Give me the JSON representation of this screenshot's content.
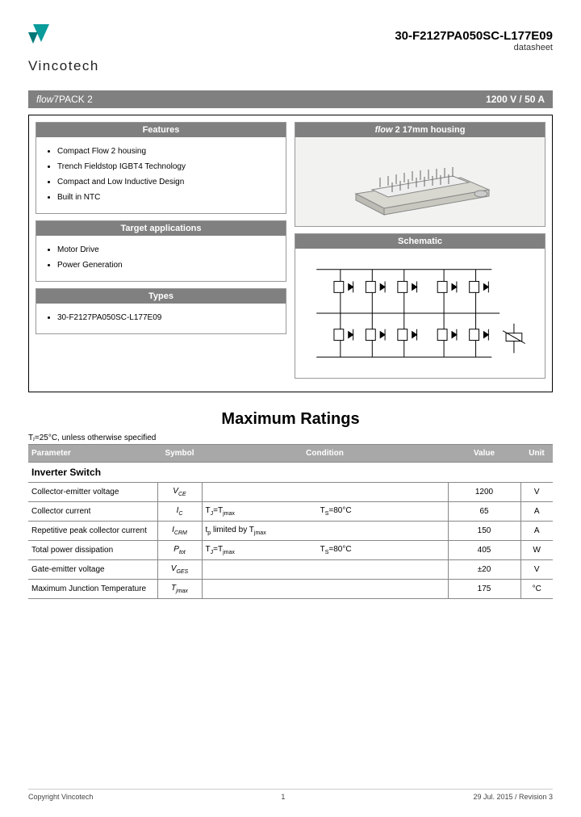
{
  "company": "Vincotech",
  "part_number": "30-F2127PA050SC-L177E09",
  "doc_type": "datasheet",
  "banner": {
    "family_italic": "flow",
    "family_name": "7PACK 2",
    "rating": "1200 V / 50 A"
  },
  "panels": {
    "features_title": "Features",
    "features": [
      "Compact Flow 2 housing",
      "Trench Fieldstop IGBT4 Technology",
      "Compact and Low Inductive Design",
      "Built in NTC"
    ],
    "apps_title": "Target applications",
    "apps": [
      "Motor Drive",
      "Power Generation"
    ],
    "types_title": "Types",
    "types": [
      "30-F2127PA050SC-L177E09"
    ],
    "housing_title_italic": "flow",
    "housing_title_rest": " 2 17mm housing",
    "schematic_title": "Schematic"
  },
  "ratings": {
    "title": "Maximum Ratings",
    "note": "Tⱼ=25°C, unless otherwise specified",
    "headers": [
      "Parameter",
      "Symbol",
      "Condition",
      "Value",
      "Unit"
    ],
    "subhead": "Inverter Switch",
    "rows": [
      {
        "param": "Collector-emitter voltage",
        "sym": "V_CE",
        "cond1": "",
        "cond2": "",
        "val": "1200",
        "unit": "V"
      },
      {
        "param": "Collector current",
        "sym": "I_C",
        "cond1": "T_J=T_jmax",
        "cond2": "T_S=80°C",
        "val": "65",
        "unit": "A"
      },
      {
        "param": "Repetitive peak collector current",
        "sym": "I_CRM",
        "cond1": "t_p limited by T_jmax",
        "cond2": "",
        "val": "150",
        "unit": "A"
      },
      {
        "param": "Total power dissipation",
        "sym": "P_tot",
        "cond1": "T_J=T_jmax",
        "cond2": "T_S=80°C",
        "val": "405",
        "unit": "W"
      },
      {
        "param": "Gate-emitter voltage",
        "sym": "V_GES",
        "cond1": "",
        "cond2": "",
        "val": "±20",
        "unit": "V"
      },
      {
        "param": "Maximum Junction Temperature",
        "sym": "T_jmax",
        "cond1": "",
        "cond2": "",
        "val": "175",
        "unit": "°C"
      }
    ]
  },
  "footer": {
    "copyright": "Copyright Vincotech",
    "page": "1",
    "date_rev": "29 Jul. 2015 / Revision 3"
  }
}
